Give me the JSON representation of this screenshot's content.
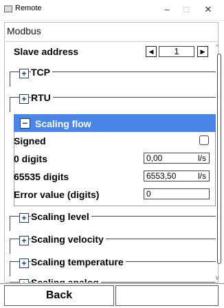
{
  "window": {
    "title": "Remote",
    "minimize": "–",
    "maximize": "□",
    "close": "✕"
  },
  "section_header": "Modbus",
  "slave_address": {
    "label": "Slave address",
    "value": "1",
    "dec_icon": "◀",
    "inc_icon": "▶"
  },
  "groups": {
    "tcp": {
      "label": "TCP",
      "icon": "+"
    },
    "rtu": {
      "label": "RTU",
      "icon": "+"
    },
    "scaling_level": {
      "label": "Scaling level",
      "icon": "+"
    },
    "scaling_velocity": {
      "label": "Scaling velocity",
      "icon": "+"
    },
    "scaling_temperature": {
      "label": "Scaling temperature",
      "icon": "+"
    },
    "scaling_analog": {
      "label": "Scaling analog",
      "icon": "+"
    }
  },
  "scaling_flow": {
    "title": "Scaling flow",
    "icon": "–",
    "signed": {
      "label": "Signed",
      "checked": false
    },
    "zero_digits": {
      "label": "0 digits",
      "value": "0,00",
      "unit": "l/s"
    },
    "max_digits": {
      "label": "65535 digits",
      "value": "6553,50",
      "unit": "l/s"
    },
    "error_value": {
      "label": "Error value (digits)",
      "value": "0"
    }
  },
  "scroll": {
    "up_icon": "^",
    "down_icon": "v"
  },
  "bottom": {
    "back_label": "Back",
    "right_label": ""
  },
  "colors": {
    "accent": "#4a86e8",
    "border": "#444444"
  }
}
